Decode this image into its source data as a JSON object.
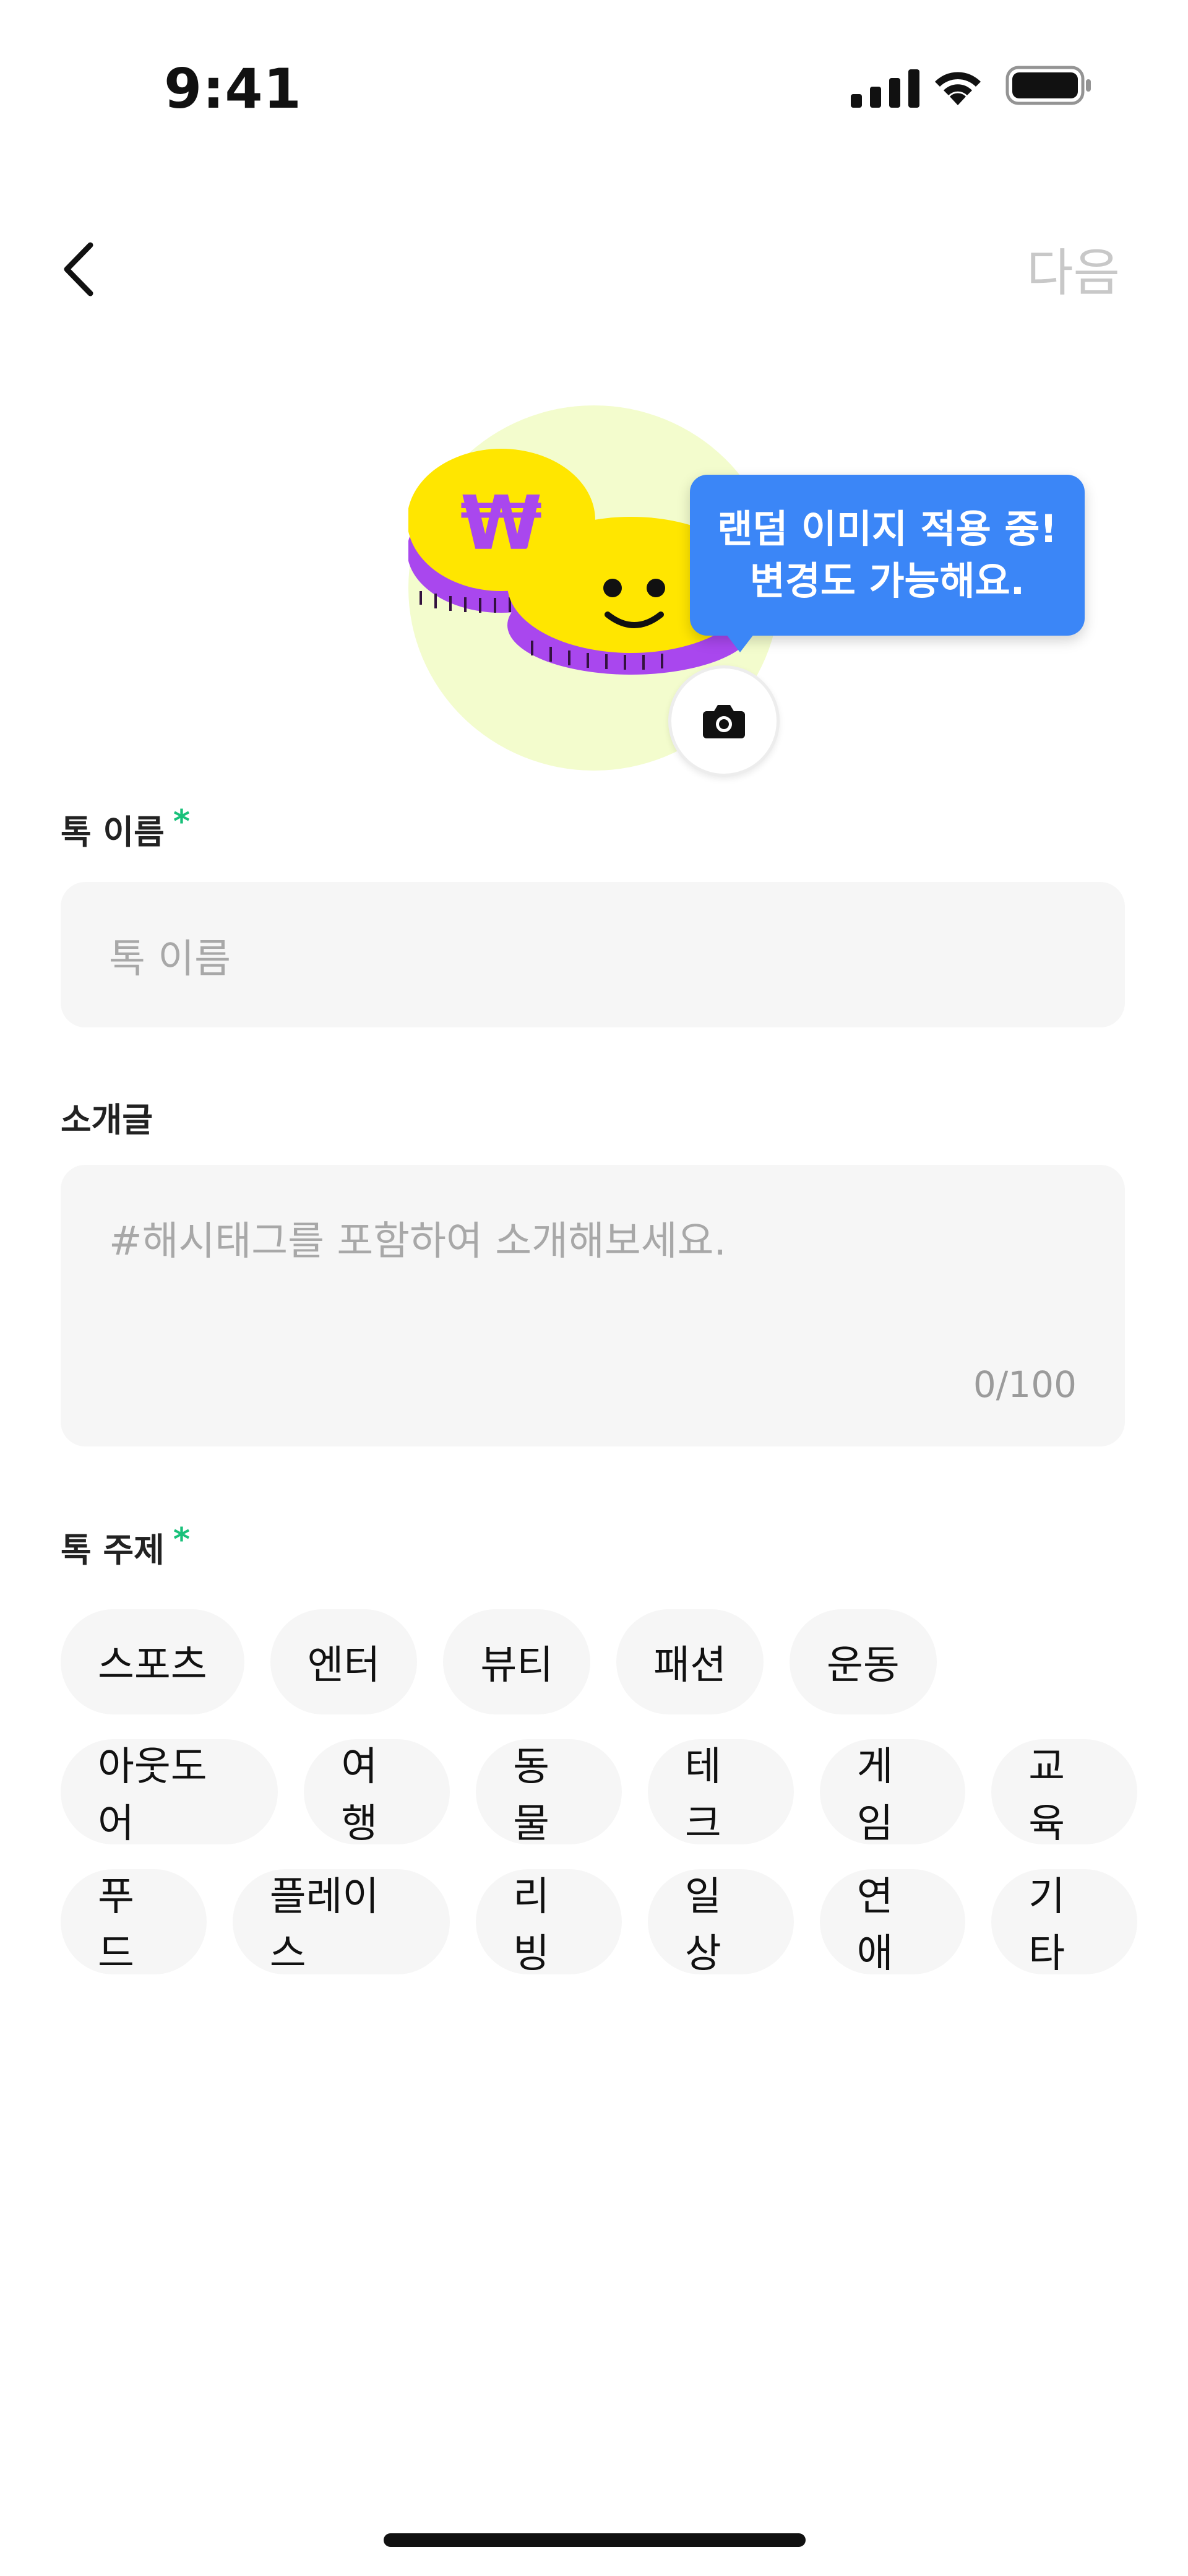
{
  "status": {
    "time": "9:41"
  },
  "nav": {
    "next_label": "다음"
  },
  "tooltip": {
    "line1": "랜덤 이미지 적용 중!",
    "line2": "변경도 가능해요."
  },
  "form": {
    "name_label": "톡 이름",
    "name_placeholder": "톡 이름",
    "intro_label": "소개글",
    "intro_placeholder": "#해시태그를 포함하여 소개해보세요.",
    "intro_counter": "0/100",
    "topic_label": "톡 주제",
    "required_mark": "*"
  },
  "topics": [
    [
      "스포츠",
      "엔터",
      "뷰티",
      "패션",
      "운동"
    ],
    [
      "아웃도어",
      "여행",
      "동물",
      "테크",
      "게임",
      "교육"
    ],
    [
      "푸드",
      "플레이스",
      "리빙",
      "일상",
      "연애",
      "기타"
    ]
  ],
  "colors": {
    "accent": "#3b86f7",
    "required": "#19c17a",
    "avatar_bg": "#f3fccd"
  },
  "icons": [
    "signal-icon",
    "wifi-icon",
    "battery-icon",
    "back-arrow-icon",
    "camera-icon"
  ]
}
